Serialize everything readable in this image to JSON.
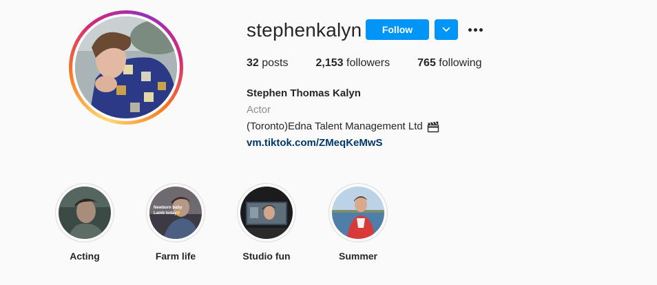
{
  "profile": {
    "username": "stephenkalyn",
    "follow_label": "Follow",
    "stats": {
      "posts_count": "32",
      "posts_label": "posts",
      "followers_count": "2,153",
      "followers_label": "followers",
      "following_count": "765",
      "following_label": "following"
    },
    "bio": {
      "full_name": "Stephen Thomas Kalyn",
      "category": "Actor",
      "description": "(Toronto)Edna Talent Management Ltd",
      "description_emoji": "clapper-board-icon",
      "link": "vm.tiktok.com/ZMeqKeMwS"
    }
  },
  "highlights": [
    {
      "label": "Acting"
    },
    {
      "label": "Farm life",
      "overlay_text": "Newborn baby\nLamb today"
    },
    {
      "label": "Studio fun"
    },
    {
      "label": "Summer"
    }
  ],
  "colors": {
    "accent": "#0095f6",
    "link": "#00376b",
    "secondary_text": "#8e8e8e"
  }
}
